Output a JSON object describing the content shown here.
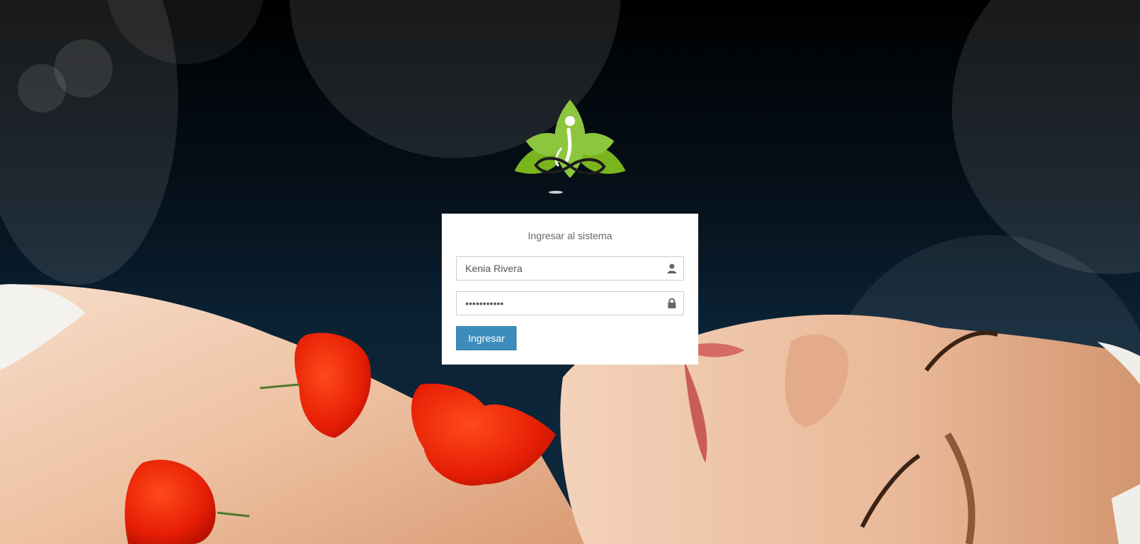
{
  "login": {
    "title": "Ingresar al sistema",
    "username": {
      "value": "Kenia Rivera",
      "icon": "user-icon"
    },
    "password": {
      "value": "•••••••••••",
      "icon": "lock-icon"
    },
    "submit_label": "Ingresar"
  },
  "brand": {
    "logo_icon": "lotus-yoga-logo",
    "logo_green": "#8cc63f",
    "accent_button": "#3c8dbc"
  },
  "background": {
    "description_icon": "spa-photo-background"
  }
}
